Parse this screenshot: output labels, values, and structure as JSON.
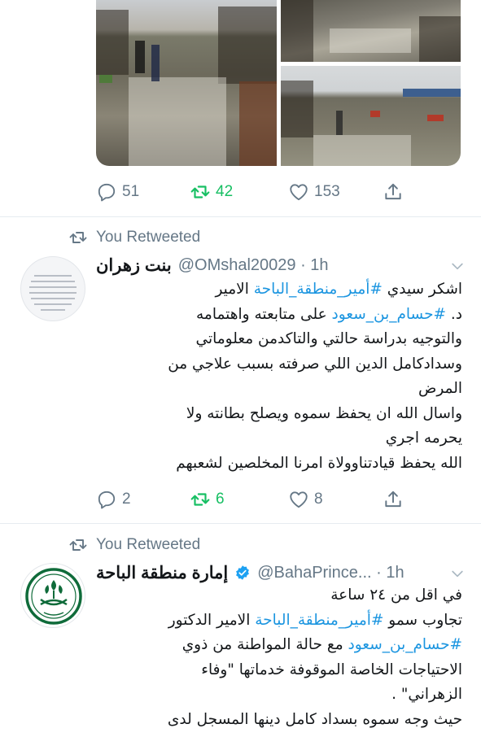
{
  "tweets": [
    {
      "stats": {
        "replies": "51",
        "retweets": "42",
        "likes": "153"
      }
    },
    {
      "retweeted_label": "You Retweeted",
      "author_name": "بنت زهران",
      "handle_time": "@OMshal20029 · 1h",
      "body": {
        "l1_a": "اشكر سيدي ",
        "l1_tag": "#أمير_منطقة_الباحة",
        "l1_b": " الامير",
        "l2_a": "د. ",
        "l2_tag": "#حسام_بن_سعود",
        "l2_b": " على متابعته واهتمامه",
        "l3": "والتوجيه بدراسة حالتي والتاكدمن معلوماتي",
        "l4": "وسدادكامل الدين اللي صرفته بسبب علاجي من",
        "l5": "المرض",
        "l6": "واسال الله ان يحفظ سموه ويصلح بطانته ولا",
        "l7": "يحرمه اجري",
        "l8": "الله يحفظ قيادتناوولاة امرنا المخلصين لشعبهم"
      },
      "stats": {
        "replies": "2",
        "retweets": "6",
        "likes": "8"
      }
    },
    {
      "retweeted_label": "You Retweeted",
      "author_name": "إمارة منطقة الباحة",
      "handle_time": "@BahaPrince... · 1h",
      "body": {
        "l1": "في اقل من ٢٤ ساعة",
        "l2_a": "تجاوب سمو ",
        "l2_tag": "#أمير_منطقة_الباحة",
        "l2_b": " الامير الدكتور",
        "l3_tag": "#حسام_بن_سعود",
        "l3_b": " مع حالة المواطنة من ذوي",
        "l4": "الاحتياجات الخاصة الموقوفة خدماتها \"وفاء",
        "l5": "الزهراني\" .",
        "l6": "حيث وجه سموه بسداد كامل دينها المسجل لدى"
      }
    }
  ],
  "icons": {
    "reply": "reply-icon",
    "retweet": "retweet-icon",
    "like": "heart-icon",
    "share": "share-icon",
    "caret": "chevron-down-icon",
    "verified": "verified-badge-icon"
  },
  "colors": {
    "retweet_active": "#17bf63",
    "hashtag": "#1b95e0",
    "secondary_text": "#657786",
    "verified": "#1da1f2",
    "emblem_green": "#0f6b3a"
  }
}
